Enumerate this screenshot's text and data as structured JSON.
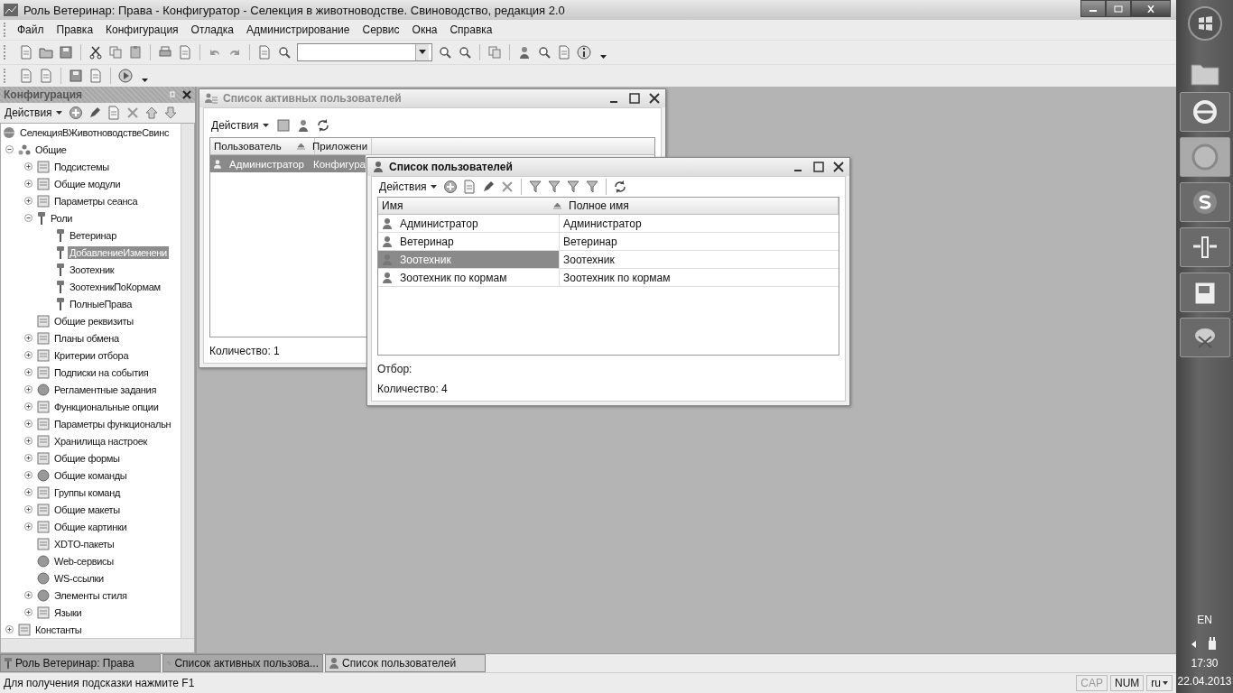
{
  "window": {
    "title": "Роль Ветеринар: Права - Конфигуратор - Селекция в животноводстве. Свиноводство, редакция 2.0"
  },
  "menu": [
    "Файл",
    "Правка",
    "Конфигурация",
    "Отладка",
    "Администрирование",
    "Сервис",
    "Окна",
    "Справка"
  ],
  "config_panel": {
    "title": "Конфигурация",
    "actions": "Действия",
    "tree": [
      {
        "label": "СелекцияВЖивотноводствеСвинс",
        "kind": "root",
        "selected": false,
        "children": [
          {
            "label": "Общие",
            "kind": "group",
            "expanded": true,
            "selected": false,
            "children": [
              {
                "label": "Подсистемы",
                "kind": "object",
                "expanded": false,
                "selected": false
              },
              {
                "label": "Общие модули",
                "kind": "object",
                "expanded": false,
                "selected": false
              },
              {
                "label": "Параметры сеанса",
                "kind": "object",
                "expanded": false,
                "selected": false
              },
              {
                "label": "Роли",
                "kind": "role",
                "expanded": true,
                "selected": false,
                "children": [
                  {
                    "label": "Ветеринар",
                    "kind": "role",
                    "selected": false
                  },
                  {
                    "label": "ДобавлениеИзменени",
                    "kind": "role",
                    "selected": true
                  },
                  {
                    "label": "Зоотехник",
                    "kind": "role",
                    "selected": false
                  },
                  {
                    "label": "ЗоотехникПоКормам",
                    "kind": "role",
                    "selected": false
                  },
                  {
                    "label": "ПолныеПрава",
                    "kind": "role",
                    "selected": false
                  }
                ]
              },
              {
                "label": "Общие реквизиты",
                "kind": "object",
                "selected": false
              },
              {
                "label": "Планы обмена",
                "kind": "object",
                "expanded": false,
                "selected": false
              },
              {
                "label": "Критерии отбора",
                "kind": "object",
                "expanded": false,
                "selected": false
              },
              {
                "label": "Подписки на события",
                "kind": "object",
                "expanded": false,
                "selected": false
              },
              {
                "label": "Регламентные задания",
                "kind": "ball",
                "expanded": false,
                "selected": false
              },
              {
                "label": "Функциональные опции",
                "kind": "object",
                "expanded": false,
                "selected": false
              },
              {
                "label": "Параметры функциональн",
                "kind": "object",
                "expanded": false,
                "selected": false
              },
              {
                "label": "Хранилища настроек",
                "kind": "object",
                "expanded": false,
                "selected": false
              },
              {
                "label": "Общие формы",
                "kind": "object",
                "expanded": false,
                "selected": false
              },
              {
                "label": "Общие команды",
                "kind": "ball",
                "expanded": false,
                "selected": false
              },
              {
                "label": "Группы команд",
                "kind": "object",
                "expanded": false,
                "selected": false
              },
              {
                "label": "Общие макеты",
                "kind": "object",
                "expanded": false,
                "selected": false
              },
              {
                "label": "Общие картинки",
                "kind": "object",
                "expanded": false,
                "selected": false
              },
              {
                "label": "XDTO-пакеты",
                "kind": "object",
                "selected": false
              },
              {
                "label": "Web-сервисы",
                "kind": "ball",
                "selected": false
              },
              {
                "label": "WS-ссылки",
                "kind": "ball",
                "selected": false
              },
              {
                "label": "Элементы стиля",
                "kind": "ball",
                "expanded": false,
                "selected": false
              },
              {
                "label": "Языки",
                "kind": "object",
                "expanded": false,
                "selected": false
              }
            ]
          },
          {
            "label": "Константы",
            "kind": "object",
            "expanded": false,
            "selected": false
          }
        ]
      }
    ]
  },
  "active_users": {
    "title": "Список активных пользователей",
    "actions": "Действия",
    "columns": [
      "Пользователь",
      "Приложени"
    ],
    "rows": [
      {
        "cells": [
          "Администратор",
          "Конфигура"
        ],
        "selected": true
      }
    ],
    "count": "Количество:  1"
  },
  "users": {
    "title": "Список пользователей",
    "actions": "Действия",
    "columns": [
      "Имя",
      "Полное имя"
    ],
    "rows": [
      {
        "cells": [
          "Администратор",
          "Администратор"
        ],
        "selected": false
      },
      {
        "cells": [
          "Ветеринар",
          "Ветеринар"
        ],
        "selected": false
      },
      {
        "cells": [
          "Зоотехник",
          "Зоотехник"
        ],
        "selected": true
      },
      {
        "cells": [
          "Зоотехник по кормам",
          "Зоотехник по кормам"
        ],
        "selected": false
      }
    ],
    "filter": "Отбор:",
    "count": "Количество: 4"
  },
  "window_tabs": [
    {
      "label": "Роль Ветеринар: Права",
      "kind": "role",
      "selected": false
    },
    {
      "label": "Список активных пользова...",
      "kind": "active",
      "selected": false
    },
    {
      "label": "Список пользователей",
      "kind": "user",
      "selected": true
    }
  ],
  "status_bar": {
    "hint": "Для получения подсказки нажмите F1",
    "indicators": [
      {
        "label": "CAP",
        "on": false
      },
      {
        "label": "NUM",
        "on": true
      }
    ],
    "language": "ru"
  },
  "taskbar": {
    "language": "EN",
    "time": "17:30",
    "date": "22.04.2013"
  }
}
